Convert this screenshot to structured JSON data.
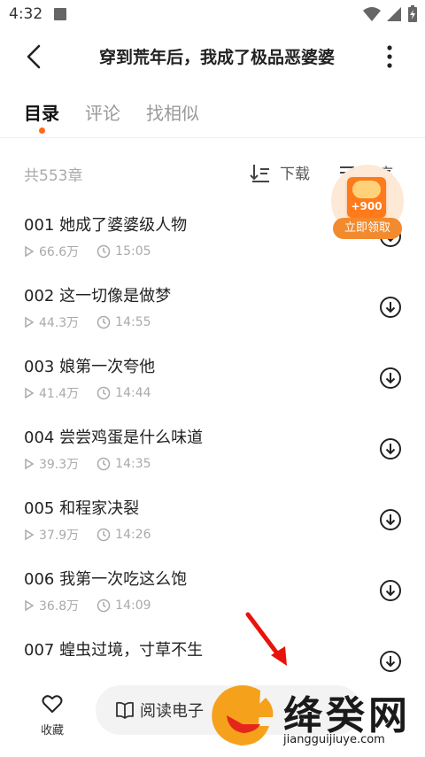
{
  "status_bar": {
    "time": "4:32"
  },
  "header": {
    "title": "穿到荒年后，我成了极品恶婆婆"
  },
  "tabs": [
    {
      "label": "目录",
      "active": true
    },
    {
      "label": "评论",
      "active": false
    },
    {
      "label": "找相似",
      "active": false
    }
  ],
  "list_header": {
    "count": "共553章",
    "download_label": "下载",
    "sort_label": "倒序"
  },
  "chapters": [
    {
      "title": "001 她成了婆婆级人物",
      "views": "66.6万",
      "time": "15:05"
    },
    {
      "title": "002 这一切像是做梦",
      "views": "44.3万",
      "time": "14:55"
    },
    {
      "title": "003 娘第一次夸他",
      "views": "41.4万",
      "time": "14:44"
    },
    {
      "title": "004 尝尝鸡蛋是什么味道",
      "views": "39.3万",
      "time": "14:35"
    },
    {
      "title": "005 和程家决裂",
      "views": "37.9万",
      "time": "14:26"
    },
    {
      "title": "006 我第一次吃这么饱",
      "views": "36.8万",
      "time": "14:09"
    },
    {
      "title": "007 蝗虫过境，寸草不生",
      "views": "",
      "time": ""
    }
  ],
  "promo": {
    "amount": "+900",
    "cta": "立即领取"
  },
  "bottom_bar": {
    "favorite_label": "收藏",
    "read_label": "阅读电子"
  },
  "watermark": {
    "brand": "绛癸网",
    "url": "jiangguijiuye.com"
  },
  "colors": {
    "accent": "#ff6a1a",
    "promo": "#f28a2e",
    "arrow": "#e8140c"
  }
}
